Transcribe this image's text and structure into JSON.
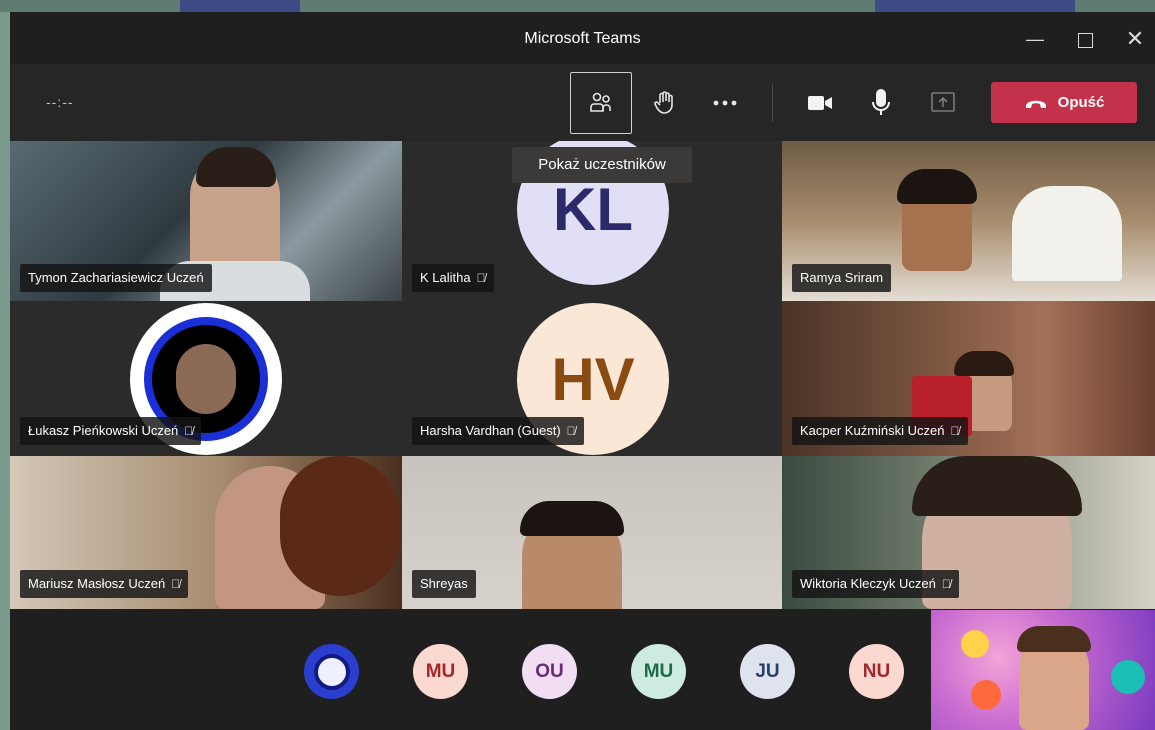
{
  "window": {
    "title": "Microsoft Teams"
  },
  "toolbar": {
    "timer": "--:--",
    "leave_label": "Opuść",
    "tooltip": "Pokaż uczestników"
  },
  "participants": [
    {
      "name": "Tymon Zachariasiewicz Uczeń"
    },
    {
      "name": "K Lalitha",
      "initials": "KL"
    },
    {
      "name": "Ramya Sriram"
    },
    {
      "name": "Łukasz Pieńkowski Uczeń"
    },
    {
      "name": "Harsha Vardhan (Guest)",
      "initials": "HV"
    },
    {
      "name": "Kacper Kuźmiński Uczeń"
    },
    {
      "name": "Mariusz Masłosz Uczeń"
    },
    {
      "name": "Shreyas"
    },
    {
      "name": "Wiktoria Kleczyk Uczeń"
    }
  ],
  "overflow": [
    "MU",
    "OU",
    "MU",
    "JU",
    "NU"
  ],
  "colors": {
    "leave": "#c4314b",
    "kl_bg": "#e0dff5",
    "kl_fg": "#2d2a6b",
    "hv_bg": "#fbe7d5",
    "hv_fg": "#8a4b12"
  },
  "icons": [
    "participants-icon",
    "raise-hand-icon",
    "more-icon",
    "camera-icon",
    "mic-icon",
    "share-icon",
    "hangup-icon",
    "mic-off-icon"
  ]
}
